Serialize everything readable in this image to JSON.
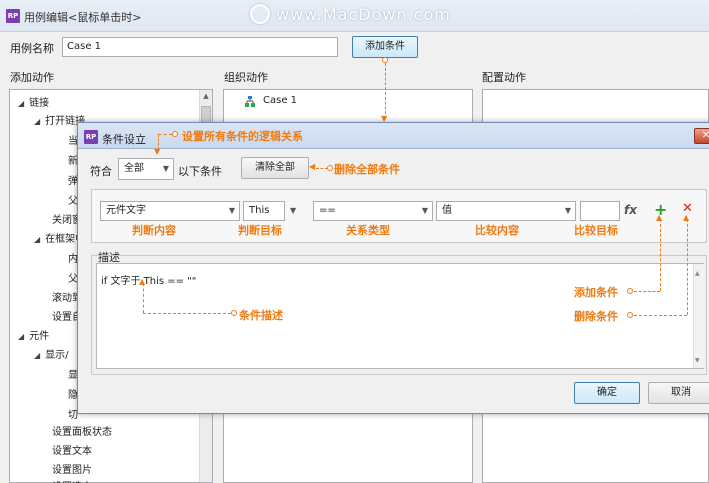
{
  "window": {
    "title": "用例编辑<鼠标单击时>",
    "logo": "RP"
  },
  "watermark": "www.MacDown.com",
  "case_name": {
    "label": "用例名称",
    "value": "Case 1"
  },
  "add_condition_button": "添加条件",
  "columns": {
    "add_actions": "添加动作",
    "organize_actions": "组织动作",
    "configure_actions": "配置动作"
  },
  "tree": [
    {
      "label": "链接",
      "expander": true
    },
    {
      "label": "打开链接",
      "expander": true
    },
    {
      "label": "关闭窗",
      "expander": false
    },
    {
      "label": "在框架中",
      "expander": true
    },
    {
      "label": "滚动到",
      "expander": false
    },
    {
      "label": "设置自",
      "expander": false
    },
    {
      "label": "元件",
      "expander": true
    },
    {
      "label": "显示/",
      "expander": true
    },
    {
      "label": "设置面板状态",
      "expander": false
    },
    {
      "label": "设置文本",
      "expander": false
    },
    {
      "label": "设置图片",
      "expander": false
    },
    {
      "label": "设置选中",
      "expander": false
    }
  ],
  "tree_clipped": [
    "当",
    "新",
    "弹",
    "父",
    "内",
    "父",
    "显",
    "隐",
    "切"
  ],
  "case_item": "Case 1",
  "dialog": {
    "title": "条件设立",
    "match_label": "符合",
    "match_value": "全部",
    "match_suffix": "以下条件",
    "clear_all_button": "清除全部",
    "condition": {
      "content": "元件文字",
      "target": "This",
      "operator": "==",
      "compare_content": "值",
      "compare_target": "",
      "fx": "fx"
    },
    "description_label": "描述",
    "description_text": "if 文字于 This == \"\"",
    "ok_button": "确定",
    "cancel_button": "取消"
  },
  "annotations": {
    "logic": "设置所有条件的逻辑关系",
    "delete_all": "删除全部条件",
    "judge_content": "判断内容",
    "judge_target": "判断目标",
    "relation_type": "关系类型",
    "compare_content": "比较内容",
    "compare_target": "比较目标",
    "add_condition": "添加条件",
    "delete_condition": "删除条件",
    "condition_description": "条件描述"
  },
  "colors": {
    "annotation": "#f07b12",
    "accent_blue": "#3c7fb1",
    "logo_purple": "#7a3fb0",
    "add_green": "#2e9e2e",
    "delete_red": "#d0281c"
  }
}
